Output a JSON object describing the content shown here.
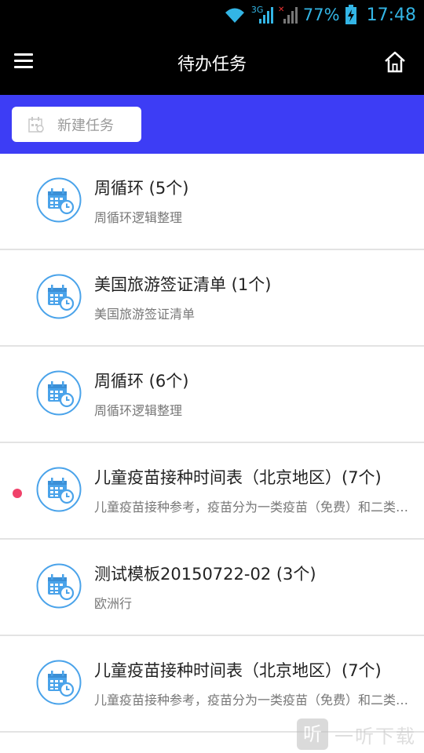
{
  "status_bar": {
    "network_label": "3G",
    "battery_percent": "77%",
    "time": "17:48"
  },
  "app_bar": {
    "title": "待办任务"
  },
  "toolbar": {
    "new_task_label": "新建任务"
  },
  "tasks": [
    {
      "title": "周循环 (5个)",
      "subtitle": "周循环逻辑整理",
      "unread": false
    },
    {
      "title": "美国旅游签证清单 (1个)",
      "subtitle": "美国旅游签证清单",
      "unread": false
    },
    {
      "title": "周循环 (6个)",
      "subtitle": "周循环逻辑整理",
      "unread": false
    },
    {
      "title": "儿童疫苗接种时间表（北京地区）(7个)",
      "subtitle": "儿童疫苗接种参考，疫苗分为一类疫苗（免费）和二类疫苗（自费）",
      "unread": true
    },
    {
      "title": "测试模板20150722-02 (3个)",
      "subtitle": "欧洲行",
      "unread": false
    },
    {
      "title": "儿童疫苗接种时间表（北京地区）(7个)",
      "subtitle": "儿童疫苗接种参考，疫苗分为一类疫苗（免费）和二类疫苗（自费）",
      "unread": false
    }
  ],
  "watermark": {
    "logo_char": "听",
    "text": "一听下载"
  },
  "colors": {
    "toolbar_bg": "#3d3df5",
    "icon_blue": "#4aa3ea",
    "unread_dot": "#f0426a",
    "status_accent": "#33b5e5"
  }
}
